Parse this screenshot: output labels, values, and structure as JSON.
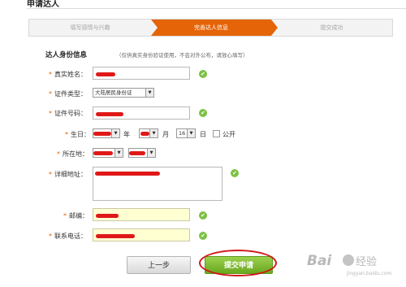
{
  "page": {
    "title": "申请达人"
  },
  "steps": [
    {
      "label": "填写感情与兴趣",
      "active": false
    },
    {
      "label": "完善达人信息",
      "active": true
    },
    {
      "label": "提交成功",
      "active": false
    }
  ],
  "section": {
    "title": "达人身份信息",
    "note": "（仅供真实身份验证使用，不会对外公布，请放心填写）"
  },
  "form": {
    "required_mark": "*",
    "real_name": {
      "label": "真实姓名："
    },
    "id_type": {
      "label": "证件类型：",
      "value": "大陆居民身份证"
    },
    "id_number": {
      "label": "证件号码："
    },
    "birthday": {
      "label": "生日：",
      "year_unit": "年",
      "month_unit": "月",
      "day_value": "16",
      "day_unit": "日",
      "public_label": "公开"
    },
    "location": {
      "label": "所在地："
    },
    "address": {
      "label": "详细地址："
    },
    "postcode": {
      "label": "邮编："
    },
    "phone": {
      "label": "联系电话："
    }
  },
  "icons": {
    "ok": "check-circle-icon",
    "dropdown": "dropdown-arrow-icon"
  },
  "glyphs": {
    "check": "✔",
    "arrow": "▼"
  },
  "buttons": {
    "prev": "上一步",
    "submit": "提交申请"
  },
  "watermark": {
    "brand": "Bai",
    "brand_suffix": "经验",
    "url": "jingyan.baidu.com"
  },
  "colors": {
    "accent": "#e56408",
    "ok": "#7cc144",
    "submit": "#6aa81f",
    "annotation": "#d01818"
  }
}
